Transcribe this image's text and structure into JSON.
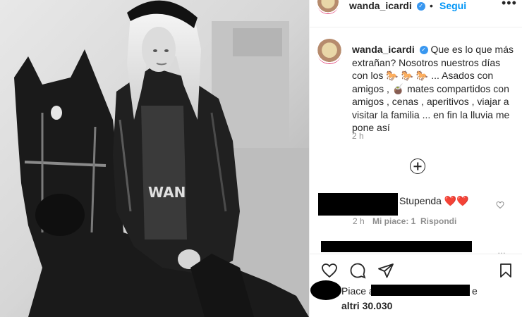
{
  "post": {
    "username": "wanda_icardi",
    "follow_label": "Segui",
    "separator": "•",
    "more_label": "•••",
    "verified_mark": "✓",
    "icons": {
      "avatar": "profile-avatar",
      "verified": "verified-badge-icon",
      "more": "more-options-icon",
      "load_more": "plus-circle-icon",
      "like": "heart-icon",
      "comment": "comment-icon",
      "share": "paper-plane-icon",
      "save": "bookmark-icon"
    }
  },
  "caption": {
    "username": "wanda_icardi",
    "lines": [
      "Que es lo que más",
      "extrañan? Nosotros nuestros días",
      "con los 🐎 🐎 🐎 ... Asados con",
      "amigos , 🧉 mates compartidos con",
      "amigos , cenas , aperitivos , viajar a",
      "visitar la familia ... en fin la lluvia me",
      "pone así"
    ],
    "time": "2 h"
  },
  "comment": {
    "text": "Stupenda",
    "emoji": "❤️❤️",
    "time": "2 h",
    "likes": "Mi piace: 1",
    "reply": "Rispondi"
  },
  "likes": {
    "prefix": "Piace a",
    "suffix": "e",
    "others": "altri 30.030"
  },
  "colors": {
    "accent": "#0095f6",
    "verified": "#3897f0",
    "text": "#262626",
    "muted": "#8e8e8e",
    "heart": "#ed4956"
  }
}
